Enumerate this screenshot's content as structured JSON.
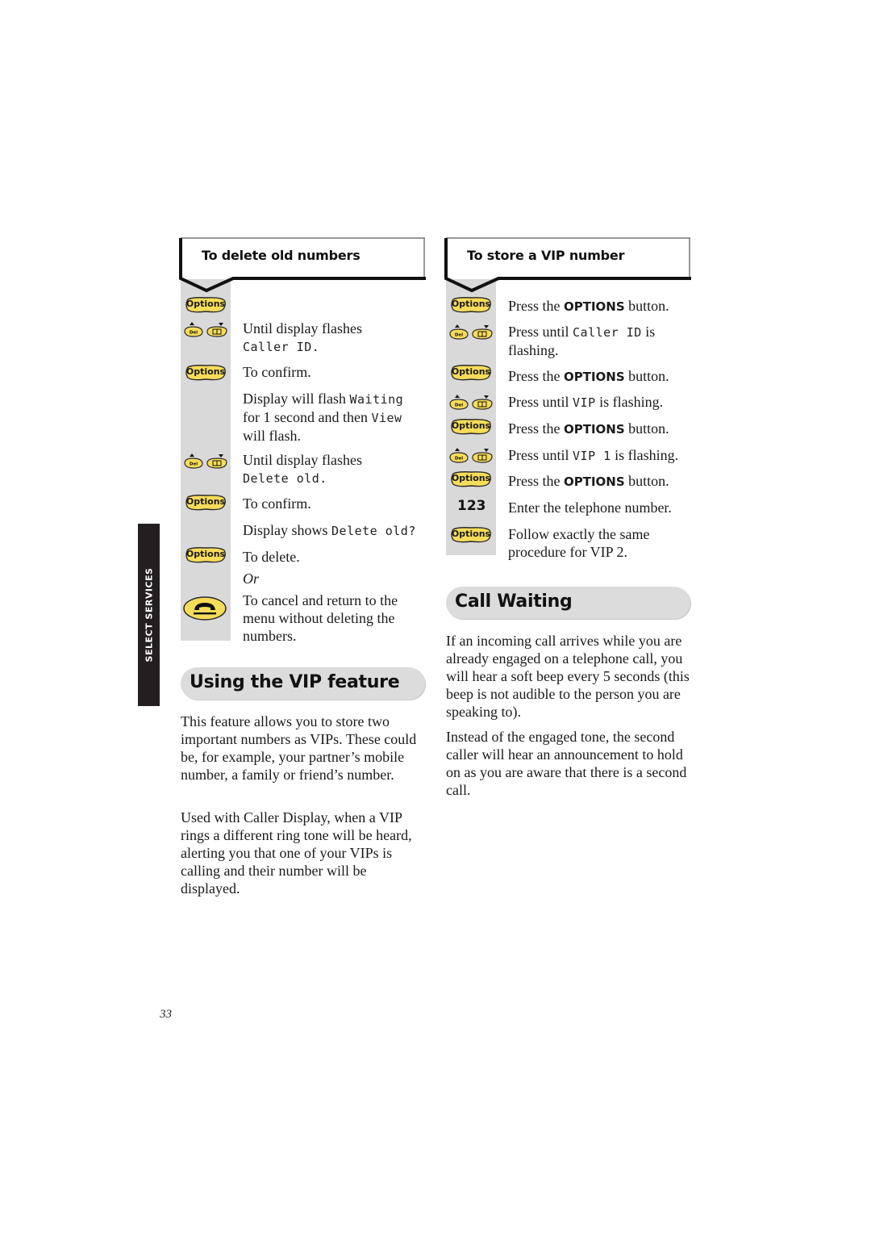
{
  "side_tab": {
    "label": "SELECT SERVICES"
  },
  "delete_section": {
    "title": "To delete old numbers",
    "steps": [
      {
        "icon": "options-button",
        "text": ""
      },
      {
        "icon": "scroll-buttons",
        "text": "Until display flashes",
        "lcd": "Caller ID."
      },
      {
        "icon": "options-button",
        "text": "To confirm."
      },
      {
        "icon": "",
        "text_a": "Display will flash ",
        "lcd_a": "Waiting",
        "text_b": "for 1 second and then ",
        "lcd_b": "View",
        "text_c": "will flash."
      },
      {
        "icon": "scroll-buttons",
        "text": "Until display flashes",
        "lcd": "Delete old."
      },
      {
        "icon": "options-button",
        "text": "To confirm."
      },
      {
        "icon": "",
        "text": "Display shows ",
        "lcd": "Delete old?"
      },
      {
        "icon": "options-button",
        "text": "To delete."
      },
      {
        "icon": "",
        "text": "Or"
      },
      {
        "icon": "hang-up-button",
        "text": "To cancel and return to the menu without deleting the numbers."
      }
    ]
  },
  "vip_section": {
    "title": "To store a VIP number",
    "steps": [
      {
        "icon": "options-button",
        "pre": "Press the ",
        "bold": "OPTIONS",
        "post": " button."
      },
      {
        "icon": "scroll-buttons",
        "pre": "Press until ",
        "lcd": "Caller ID",
        "post": " is flashing."
      },
      {
        "icon": "options-button",
        "pre": "Press the ",
        "bold": "OPTIONS",
        "post": " button."
      },
      {
        "icon": "scroll-buttons",
        "pre": "Press until ",
        "lcd": "VIP",
        "post": " is flashing."
      },
      {
        "icon": "options-button",
        "pre": "Press the ",
        "bold": "OPTIONS",
        "post": " button."
      },
      {
        "icon": "scroll-buttons",
        "pre": "Press until ",
        "lcd": "VIP 1",
        "post": " is flashing."
      },
      {
        "icon": "options-button",
        "pre": "Press the ",
        "bold": "OPTIONS",
        "post": " button."
      },
      {
        "icon": "keypad-123",
        "icon_label": "123",
        "pre": "Enter the telephone number."
      },
      {
        "icon": "options-button",
        "pre": "Follow exactly the same procedure for VIP 2."
      }
    ]
  },
  "icons": {
    "options_label": "Options",
    "del_label": "Del"
  },
  "vip_feature": {
    "heading": "Using the VIP feature",
    "paragraphs": [
      "This feature allows you to store two important numbers as VIPs. These could be, for example, your partner’s mobile number, a family or friend’s number.",
      "Used with Caller Display, when a VIP rings a different ring tone will be heard, alerting you that one of your VIPs is calling and their number will be displayed."
    ]
  },
  "call_waiting": {
    "heading": "Call Waiting",
    "paragraphs": [
      "If an incoming call arrives while you are already engaged on a telephone call, you will hear a soft beep every 5 seconds (this beep is not audible to the person you are speaking to).",
      "Instead of the engaged tone, the second caller will hear an announcement to hold on as you are aware that there is a second call."
    ]
  },
  "colors": {
    "button_yellow": "#f7dc5a",
    "step_grey": "#d9d9d9",
    "tab_black": "#231f20"
  },
  "page_number": "33"
}
